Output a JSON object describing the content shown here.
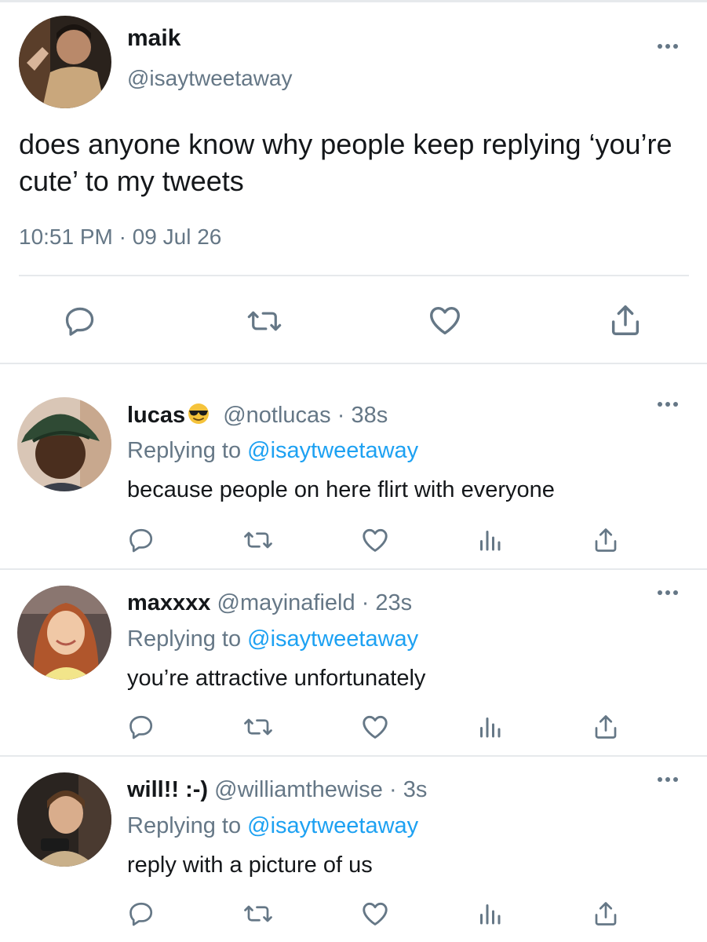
{
  "main_tweet": {
    "name": "maik",
    "handle": "@isaytweetaway",
    "text": "does anyone know why people keep replying ‘you’re cute’ to my tweets",
    "timestamp": "10:51 PM · 09 Jul 26",
    "actions": [
      "reply-icon",
      "retweet-icon",
      "like-icon",
      "share-icon"
    ]
  },
  "replies": [
    {
      "name": "lucas",
      "name_emoji": "sunglasses-emoji",
      "handle": "@notlucas",
      "time": "· 38s",
      "replying_prefix": "Replying to",
      "replying_to": "@isaytweetaway",
      "text": "because people on here flirt with everyone"
    },
    {
      "name": "maxxxx",
      "handle": "@mayinafield",
      "time": "· 23s",
      "replying_prefix": "Replying to",
      "replying_to": "@isaytweetaway",
      "text": "you’re attractive unfortunately"
    },
    {
      "name": "will!! :-)",
      "handle": "@williamthewise",
      "time": "· 3s",
      "replying_prefix": "Replying to",
      "replying_to": "@isaytweetaway",
      "text": "reply with a picture of us"
    }
  ],
  "reply_actions": [
    "reply-icon",
    "retweet-icon",
    "like-icon",
    "analytics-icon",
    "share-icon"
  ],
  "colors": {
    "text": "#14171a",
    "secondary": "#657786",
    "link": "#1da1f2",
    "divider": "#e6e9ec"
  }
}
